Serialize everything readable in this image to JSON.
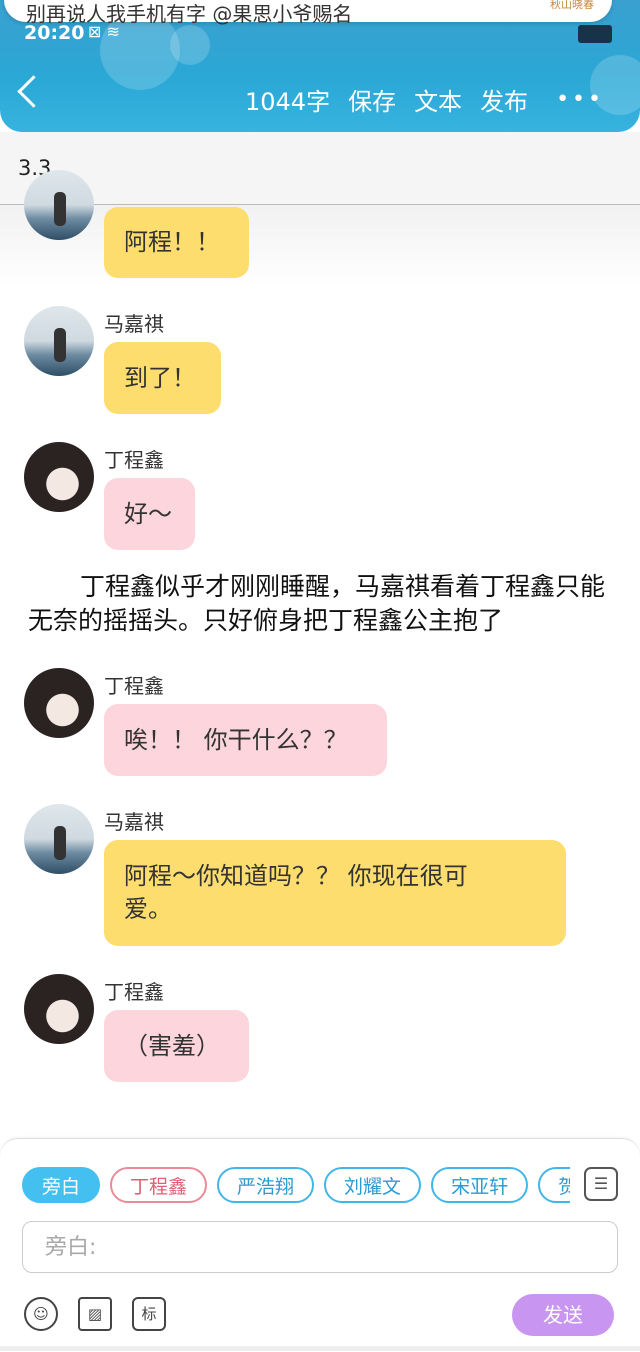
{
  "notification": {
    "text": "别再说人我手机有字  @果思小爷赐名",
    "logo": "秋山晓春"
  },
  "status_bar": {
    "time": "20:20",
    "icons": "⊠ ≋"
  },
  "header": {
    "word_count": "1044字",
    "save": "保存",
    "text": "文本",
    "publish": "发布",
    "more": "•••"
  },
  "chapter": {
    "title": "3.3"
  },
  "messages": [
    {
      "speaker": "",
      "text": "阿程！！",
      "color": "yellow"
    },
    {
      "speaker": "马嘉祺",
      "text": "到了！",
      "color": "yellow"
    },
    {
      "speaker": "丁程鑫",
      "text": "好～",
      "color": "pink"
    },
    {
      "speaker": "丁程鑫",
      "text": "唉！！ 你干什么？？",
      "color": "pink"
    },
    {
      "speaker": "马嘉祺",
      "text": "阿程～你知道吗？？ 你现在很可爱。",
      "color": "yellow"
    },
    {
      "speaker": "丁程鑫",
      "text": "（害羞）",
      "color": "pink"
    }
  ],
  "narration": "丁程鑫似乎才刚刚睡醒，马嘉祺看着丁程鑫只能无奈的摇摇头。只好俯身把丁程鑫公主抱了",
  "composer": {
    "chips": [
      "旁白",
      "丁程鑫",
      "严浩翔",
      "刘耀文",
      "宋亚轩",
      "贺"
    ],
    "placeholder": "旁白:",
    "tag_button": "标",
    "send": "发送"
  },
  "colors": {
    "header": "#2aa8d6",
    "yellow_bubble": "#fddd6e",
    "pink_bubble": "#fdd5dc",
    "send": "#c895f1"
  }
}
